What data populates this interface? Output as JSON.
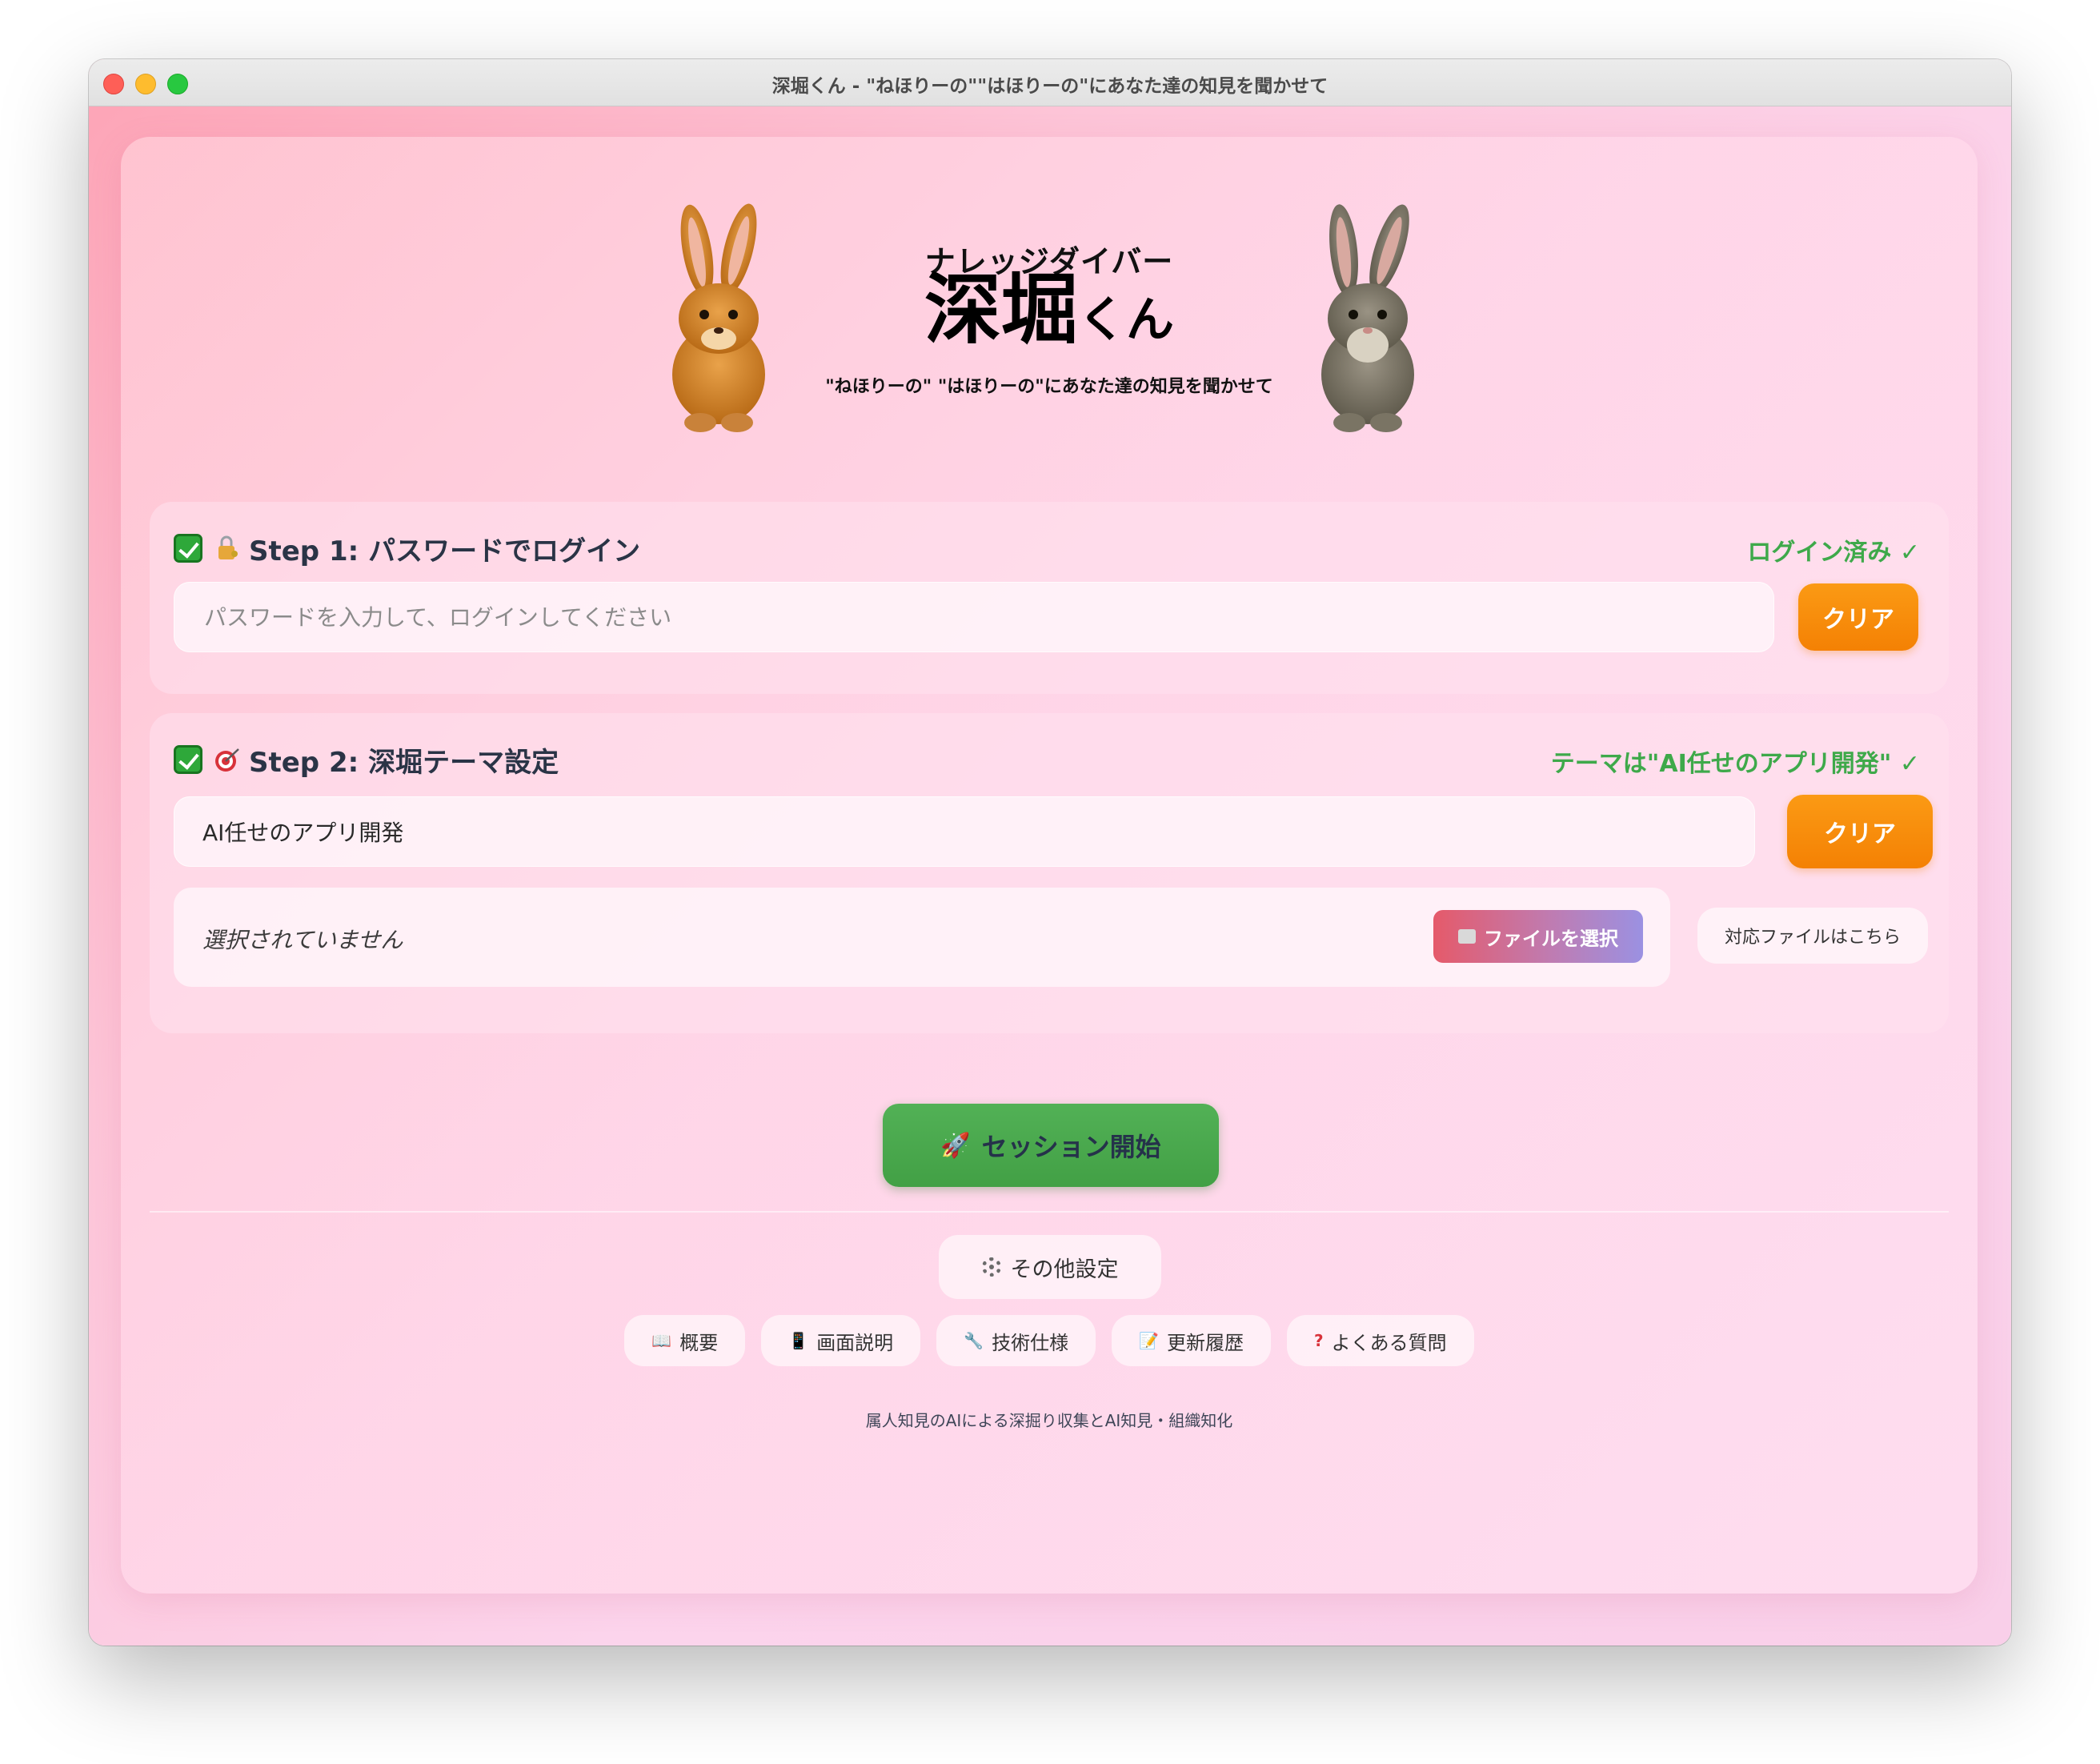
{
  "window": {
    "title": "深堀くん - \"ねほりーの\"\"はほりーの\"にあなた達の知見を聞かせて"
  },
  "header": {
    "subtitle": "ナレッジダイバー",
    "title_main": "深堀",
    "title_suffix": "くん",
    "tagline": "\"ねほりーの\" \"はほりーの\"にあなた達の知見を聞かせて"
  },
  "step1": {
    "title": "Step 1: パスワードでログイン",
    "status": "ログイン済み ✓",
    "placeholder": "パスワードを入力して、ログインしてください",
    "clear_label": "クリア"
  },
  "step2": {
    "title": "Step 2: 深堀テーマ設定",
    "status": "テーマは\"AI任せのアプリ開発\" ✓",
    "theme_value": "AI任せのアプリ開発",
    "clear_label": "クリア",
    "file_status": "選択されていません",
    "file_button": "ファイルを選択",
    "supported_files": "対応ファイルはこちら"
  },
  "start_button": "セッション開始",
  "settings_button": "その他設定",
  "links": [
    {
      "icon": "📖",
      "label": "概要"
    },
    {
      "icon": "📱",
      "label": "画面説明"
    },
    {
      "icon": "🔧",
      "label": "技術仕様"
    },
    {
      "icon": "📝",
      "label": "更新履歴"
    },
    {
      "icon": "?",
      "label": "よくある質問"
    }
  ],
  "footer": "属人知見のAIによる深掘り収集とAI知見・組織知化",
  "colors": {
    "accent_green": "#3ea94a",
    "clear_orange": "#f48104",
    "start_green": "#4aab4e"
  }
}
